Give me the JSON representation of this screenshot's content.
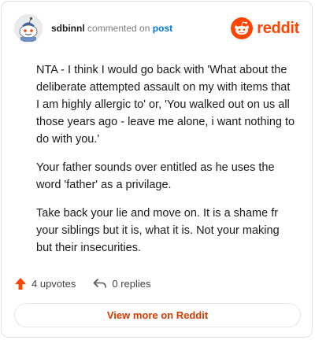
{
  "header": {
    "username": "sdbinnl",
    "action_text": "commented on",
    "post_link": "post",
    "brand": "reddit",
    "brand_color": "#ff4500"
  },
  "comment": {
    "paragraphs": [
      "NTA - I think I would go back with 'What about the deliberate attempted assault on my with items that I am highly allergic to' or, 'You walked out on us all those years ago - leave me alone, i want nothing to do with you.'",
      "Your father sounds over entitled as he uses the word 'father' as a privilage.",
      "Take back your lie and move on. It is a shame fr your siblings but it is, what it is. Not your making but their insecurities."
    ]
  },
  "footer": {
    "upvotes": "4 upvotes",
    "replies": "0 replies",
    "upvote_icon": "upvote-arrow-icon",
    "reply_icon": "reply-arrow-icon",
    "upvote_color": "#ff4500"
  },
  "cta": {
    "label": "View more on Reddit",
    "color": "#d93a00"
  }
}
